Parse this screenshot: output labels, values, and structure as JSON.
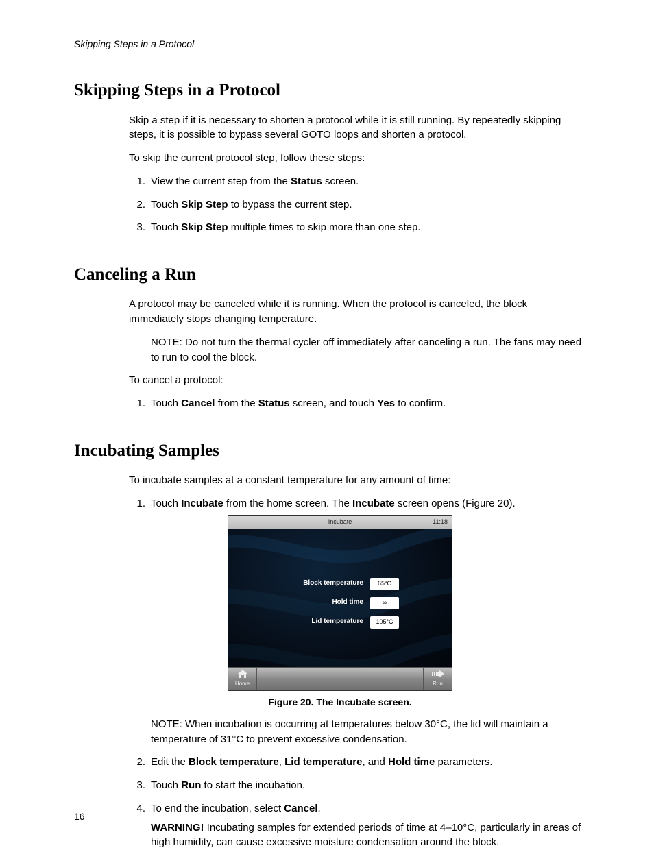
{
  "runningHead": "Skipping Steps in a Protocol",
  "pageNumber": "16",
  "sections": {
    "skip": {
      "heading": "Skipping Steps in a Protocol",
      "intro": "Skip a step if it is necessary to shorten a protocol while it is still running. By repeatedly skipping steps, it is possible to bypass several GOTO loops and shorten a protocol.",
      "lead": "To skip the current protocol step, follow these steps:",
      "steps": [
        {
          "num": "1.",
          "pre": "View the current step from the ",
          "bold1": "Status",
          "post": " screen."
        },
        {
          "num": "2.",
          "pre": "Touch ",
          "bold1": "Skip Step",
          "post": " to bypass the current step."
        },
        {
          "num": "3.",
          "pre": "Touch ",
          "bold1": "Skip Step",
          "post": " multiple times to skip more than one step."
        }
      ]
    },
    "cancel": {
      "heading": "Canceling a Run",
      "intro": "A protocol may be canceled while it is running. When the protocol is canceled, the block immediately stops changing temperature.",
      "note": "NOTE: Do not turn the thermal cycler off immediately after canceling a run. The fans may need to run to cool the block.",
      "lead": "To cancel a protocol:",
      "step1": {
        "num": "1.",
        "p1": "Touch ",
        "b1": "Cancel",
        "p2": " from the ",
        "b2": "Status",
        "p3": " screen, and touch ",
        "b3": "Yes",
        "p4": " to confirm."
      }
    },
    "incubate": {
      "heading": "Incubating Samples",
      "intro": "To incubate samples at a constant temperature for any amount of time:",
      "step1": {
        "num": "1.",
        "p1": "Touch ",
        "b1": "Incubate",
        "p2": " from the home screen. The ",
        "b2": "Incubate",
        "p3": " screen opens (Figure 20)."
      },
      "figure": {
        "caption": "Figure 20. The Incubate screen.",
        "title": "Incubate",
        "clock": "11:18",
        "params": [
          {
            "label": "Block temperature",
            "value": "65°C"
          },
          {
            "label": "Hold time",
            "value": "∞"
          },
          {
            "label": "Lid temperature",
            "value": "105°C"
          }
        ],
        "homeLabel": "Home",
        "runLabel": "Run"
      },
      "noteAfterFig": "NOTE: When incubation is occurring at temperatures below 30°C, the lid will maintain a temperature of 31°C to prevent excessive condensation.",
      "step2": {
        "num": "2.",
        "p1": "Edit the ",
        "b1": "Block temperature",
        "p2": ", ",
        "b2": "Lid temperature",
        "p3": ", and ",
        "b3": "Hold time",
        "p4": " parameters."
      },
      "step3": {
        "num": "3.",
        "p1": "Touch ",
        "b1": "Run",
        "p2": " to start the incubation."
      },
      "step4": {
        "num": "4.",
        "p1": "To end the incubation, select ",
        "b1": "Cancel",
        "p2": ".",
        "warnLabel": "WARNING!",
        "warnText": " Incubating samples for extended periods of time at 4–10°C, particularly in areas of high humidity, can cause excessive moisture condensation around the block."
      }
    }
  }
}
